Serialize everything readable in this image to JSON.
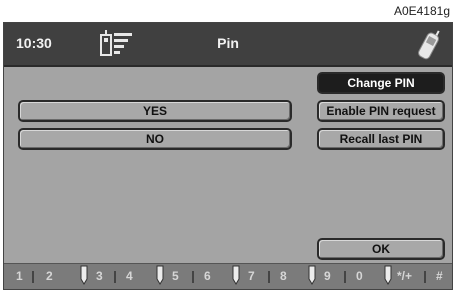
{
  "figure_ref": "A0E4181g",
  "status_bar": {
    "time": "10:30",
    "title": "Pin"
  },
  "icons": {
    "signal": "signal-strength-icon",
    "phone": "mobile-phone-icon"
  },
  "left_buttons": [
    {
      "label": "YES"
    },
    {
      "label": "NO"
    }
  ],
  "right_menu": [
    {
      "label": "Change PIN",
      "selected": true
    },
    {
      "label": "Enable PIN request",
      "selected": false
    },
    {
      "label": "Recall last PIN",
      "selected": false
    }
  ],
  "confirm_label": "OK",
  "keypad": [
    "1",
    "2",
    "3",
    "4",
    "5",
    "6",
    "7",
    "8",
    "9",
    "0",
    "*/+",
    "#"
  ]
}
